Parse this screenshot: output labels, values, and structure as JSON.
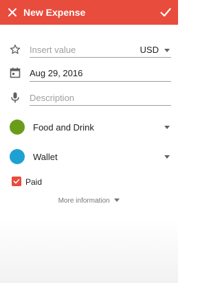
{
  "appbar": {
    "title": "New Expense",
    "close_icon": "close-icon",
    "done_icon": "check-icon",
    "color": "#e84c3d"
  },
  "value_field": {
    "icon": "star-outline-icon",
    "placeholder": "Insert value",
    "currency": "USD"
  },
  "date_field": {
    "icon": "calendar-icon",
    "value": "Aug 29, 2016"
  },
  "description_field": {
    "icon": "microphone-icon",
    "placeholder": "Description"
  },
  "category": {
    "label": "Food and Drink",
    "color": "#6a9c1b"
  },
  "account": {
    "label": "Wallet",
    "color": "#1ea1d2"
  },
  "paid": {
    "label": "Paid",
    "checked": true
  },
  "more_information": {
    "label": "More information"
  }
}
